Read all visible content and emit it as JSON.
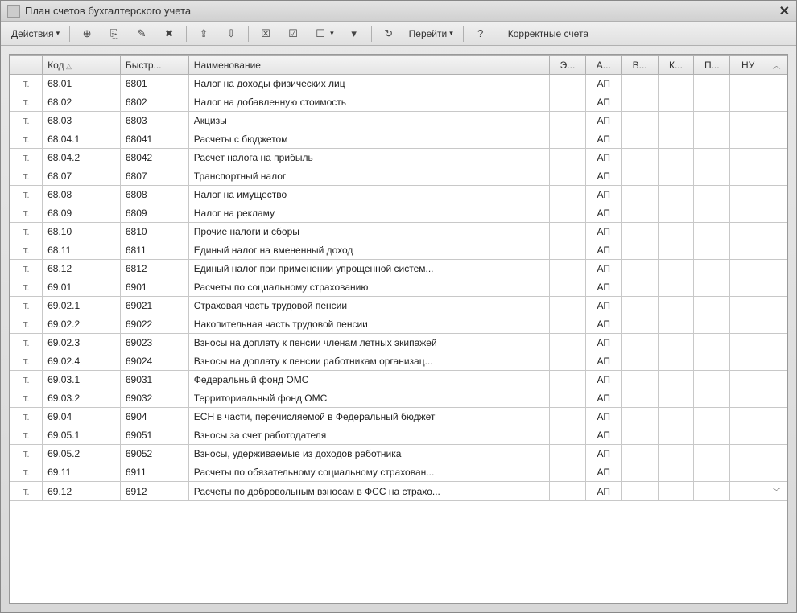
{
  "window": {
    "title": "План счетов бухгалтерского учета",
    "close_icon": "✕"
  },
  "toolbar": {
    "actions_label": "Действия",
    "goto_label": "Перейти",
    "correct_label": "Корректные счета",
    "icons": {
      "add": "⊕",
      "clone": "⎘",
      "edit": "✎",
      "mark": "✖",
      "i1": "⇪",
      "i2": "⇩",
      "i3": "☒",
      "i4": "☑",
      "i5": "☐",
      "filter": "▾",
      "refresh": "↻",
      "help": "?"
    }
  },
  "columns": {
    "type": "",
    "code": "Код",
    "fast": "Быстр...",
    "name": "Наименование",
    "c1": "Э...",
    "c2": "А...",
    "c3": "В...",
    "c4": "К...",
    "c5": "П...",
    "c6": "НУ",
    "scroll_up": "︿",
    "scroll_down": "﹀"
  },
  "row_type_icon": "Т.",
  "rows": [
    {
      "code": "68.01",
      "fast": "6801",
      "name": "Налог на доходы физических лиц",
      "c2": "АП"
    },
    {
      "code": "68.02",
      "fast": "6802",
      "name": "Налог на добавленную стоимость",
      "c2": "АП"
    },
    {
      "code": "68.03",
      "fast": "6803",
      "name": "Акцизы",
      "c2": "АП"
    },
    {
      "code": "68.04.1",
      "fast": "68041",
      "name": "Расчеты с бюджетом",
      "c2": "АП"
    },
    {
      "code": "68.04.2",
      "fast": "68042",
      "name": "Расчет налога на прибыль",
      "c2": "АП"
    },
    {
      "code": "68.07",
      "fast": "6807",
      "name": "Транспортный налог",
      "c2": "АП"
    },
    {
      "code": "68.08",
      "fast": "6808",
      "name": "Налог на имущество",
      "c2": "АП"
    },
    {
      "code": "68.09",
      "fast": "6809",
      "name": "Налог на рекламу",
      "c2": "АП"
    },
    {
      "code": "68.10",
      "fast": "6810",
      "name": "Прочие налоги и сборы",
      "c2": "АП"
    },
    {
      "code": "68.11",
      "fast": "6811",
      "name": "Единый налог на вмененный доход",
      "c2": "АП"
    },
    {
      "code": "68.12",
      "fast": "6812",
      "name": "Единый налог при применении упрощенной систем...",
      "c2": "АП"
    },
    {
      "code": "69.01",
      "fast": "6901",
      "name": "Расчеты по социальному страхованию",
      "c2": "АП"
    },
    {
      "code": "69.02.1",
      "fast": "69021",
      "name": "Страховая часть трудовой пенсии",
      "c2": "АП"
    },
    {
      "code": "69.02.2",
      "fast": "69022",
      "name": "Накопительная часть трудовой пенсии",
      "c2": "АП"
    },
    {
      "code": "69.02.3",
      "fast": "69023",
      "name": "Взносы на доплату к пенсии членам летных экипажей",
      "c2": "АП"
    },
    {
      "code": "69.02.4",
      "fast": "69024",
      "name": "Взносы на доплату к пенсии работникам организац...",
      "c2": "АП"
    },
    {
      "code": "69.03.1",
      "fast": "69031",
      "name": "Федеральный фонд ОМС",
      "c2": "АП"
    },
    {
      "code": "69.03.2",
      "fast": "69032",
      "name": "Территориальный фонд ОМС",
      "c2": "АП"
    },
    {
      "code": "69.04",
      "fast": "6904",
      "name": "ЕСН в части, перечисляемой в Федеральный бюджет",
      "c2": "АП"
    },
    {
      "code": "69.05.1",
      "fast": "69051",
      "name": "Взносы за счет работодателя",
      "c2": "АП"
    },
    {
      "code": "69.05.2",
      "fast": "69052",
      "name": "Взносы, удерживаемые из доходов работника",
      "c2": "АП"
    },
    {
      "code": "69.11",
      "fast": "6911",
      "name": "Расчеты по обязательному социальному страхован...",
      "c2": "АП"
    },
    {
      "code": "69.12",
      "fast": "6912",
      "name": "Расчеты по добровольным взносам в ФСС на страхо...",
      "c2": "АП"
    }
  ]
}
